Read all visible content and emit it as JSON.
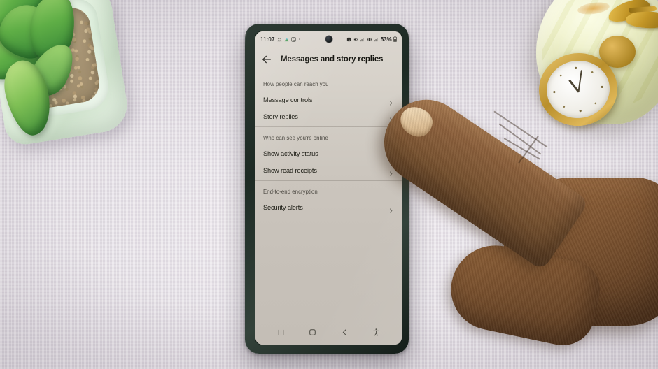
{
  "scene": {
    "description": "Hand pointing at a smartphone on a desk",
    "desk_color": "#e8e4e9",
    "objects": [
      "succulent-plant",
      "onyx-clock",
      "smartphone",
      "pointing-hand"
    ]
  },
  "phone": {
    "bezel_color": "#1d2a24",
    "screen_bg": "#c8c2ba",
    "status_bar": {
      "time": "11:07",
      "battery_percent": "53%",
      "left_icons": [
        "contacts-icon",
        "drive-icon",
        "gallery-icon",
        "more-dot-icon"
      ],
      "right_icons": [
        "alarm-icon",
        "mute-icon",
        "signal-icon",
        "vibrate-icon",
        "signal2-icon",
        "battery-icon"
      ]
    },
    "app_bar": {
      "back_label": "back-arrow",
      "title": "Messages and story replies"
    },
    "sections": [
      {
        "header": "How people can reach you",
        "items": [
          {
            "label": "Message controls",
            "chevron": true
          },
          {
            "label": "Story replies",
            "chevron": true
          }
        ]
      },
      {
        "header": "Who can see you're online",
        "items": [
          {
            "label": "Show activity status",
            "chevron": true
          },
          {
            "label": "Show read receipts",
            "chevron": true
          }
        ]
      },
      {
        "header": "End-to-end encryption",
        "items": [
          {
            "label": "Security alerts",
            "chevron": true
          }
        ]
      }
    ],
    "nav_bar": {
      "recents_label": "recents",
      "home_label": "home",
      "back_label": "back",
      "accessibility_label": "accessibility"
    }
  }
}
